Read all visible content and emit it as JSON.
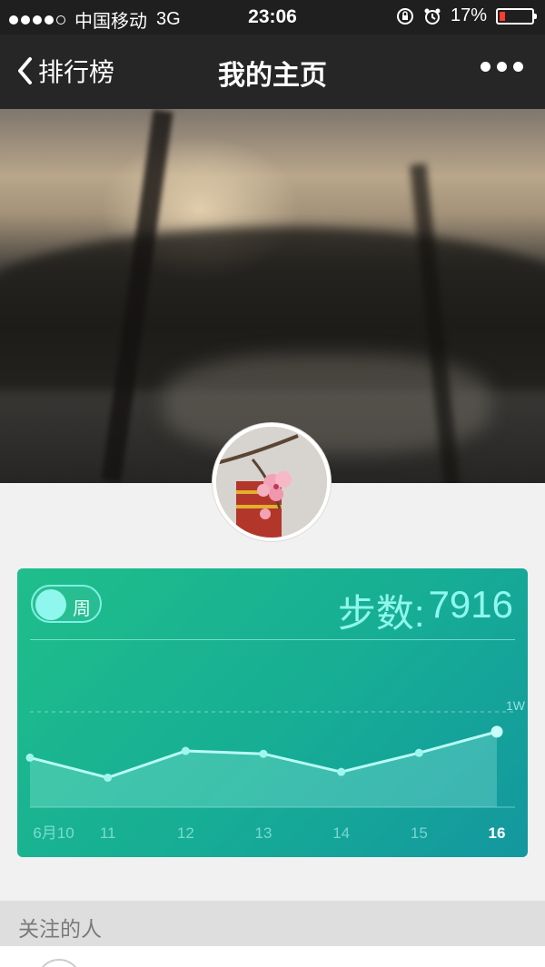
{
  "status_bar": {
    "carrier": "中国移动",
    "network": "3G",
    "time": "23:06",
    "battery": "17%",
    "battery_level": 0.17,
    "signal_bars": 4,
    "signal_max": 5,
    "icons": [
      "orientation-lock-icon",
      "alarm-icon",
      "battery-icon"
    ]
  },
  "navbar": {
    "back_label": "排行榜",
    "title": "我的主页",
    "more_icon": "more-dots-icon"
  },
  "profile": {
    "cover": "sunset-landscape-photo",
    "avatar": "cherry-blossom-photo"
  },
  "stats_card": {
    "toggle_label": "周",
    "steps_label": "步数:",
    "steps_value": "7916",
    "colors": {
      "card_start": "#1fbe8a",
      "card_end": "#13979f",
      "accent": "#8ff7ee"
    }
  },
  "chart_data": {
    "type": "area",
    "categories": [
      "6月10",
      "11",
      "12",
      "13",
      "14",
      "15",
      "16"
    ],
    "values": [
      5200,
      3100,
      5900,
      5600,
      3700,
      5700,
      7916
    ],
    "ylim": [
      0,
      10000
    ],
    "reference_line_label": "1W",
    "highlighted_category": "16",
    "grid": false
  },
  "following": {
    "section_title": "关注的人"
  }
}
